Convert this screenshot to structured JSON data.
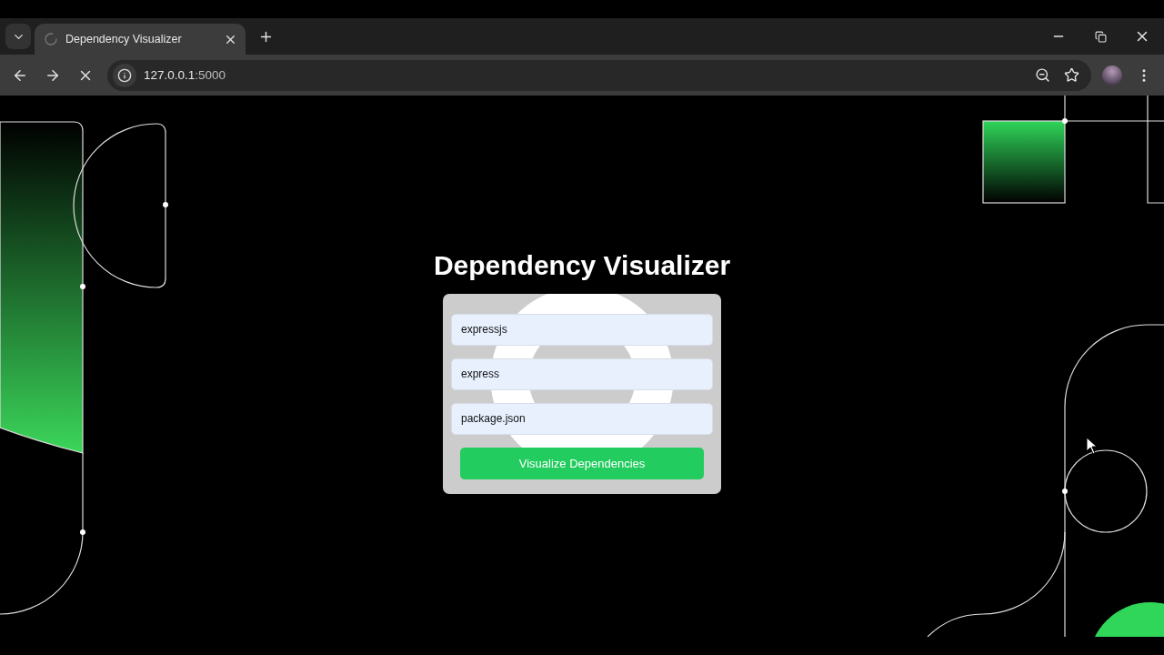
{
  "browser": {
    "tab": {
      "title": "Dependency Visualizer",
      "loading": true
    },
    "url_host": "127.0.0.1",
    "url_port": ":5000"
  },
  "page": {
    "heading": "Dependency Visualizer",
    "fields": [
      {
        "value": "expressjs"
      },
      {
        "value": "express"
      },
      {
        "value": "package.json"
      }
    ],
    "button": "Visualize Dependencies"
  }
}
